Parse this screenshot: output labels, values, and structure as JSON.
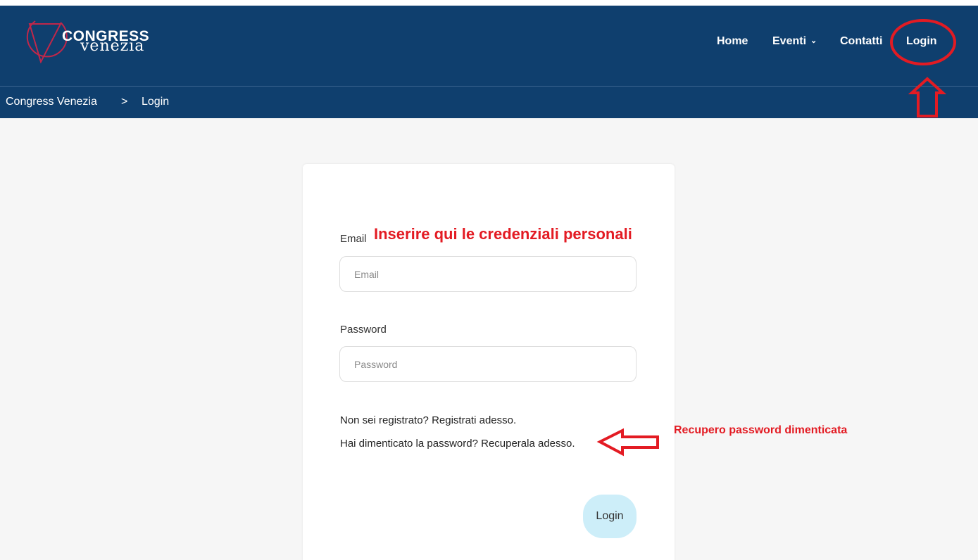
{
  "brand": {
    "word1": "CONGRESS",
    "word2": "venezia"
  },
  "nav": {
    "home": "Home",
    "eventi": "Eventi",
    "chevron": "⌄",
    "contatti": "Contatti",
    "login": "Login"
  },
  "breadcrumb": {
    "home": "Congress Venezia",
    "separator": ">",
    "current": "Login"
  },
  "form": {
    "email_label": "Email",
    "email_placeholder": "Email",
    "password_label": "Password",
    "password_placeholder": "Password",
    "register_prompt": "Non sei registrato?",
    "register_link": "Registrati adesso.",
    "forgot_prompt": "Hai dimenticato la password?",
    "forgot_link": "Recuperala adesso.",
    "submit_label": "Login"
  },
  "annotations": {
    "credentials": "Inserire qui le credenziali personali",
    "password_recovery": "Recupero password dimenticata",
    "color": "#e31b23"
  },
  "colors": {
    "header": "#0f3f6e",
    "button": "#cdeef9",
    "logo_accent": "#c0274a"
  }
}
